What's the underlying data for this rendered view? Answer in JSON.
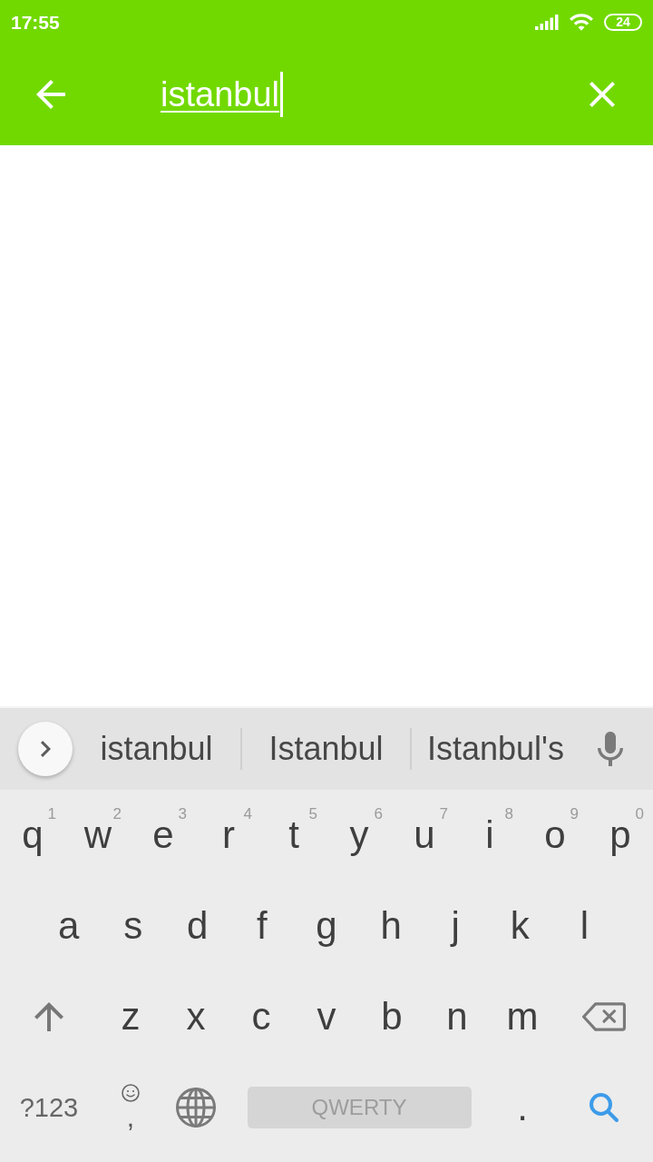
{
  "status_bar": {
    "time": "17:55",
    "battery": "24"
  },
  "search_bar": {
    "query": "istanbul"
  },
  "keyboard": {
    "suggestions": [
      {
        "text": "istanbul"
      },
      {
        "text": "Istanbul"
      },
      {
        "text": "Istanbul's"
      }
    ],
    "rows": [
      {
        "keys": [
          {
            "kind": "letter",
            "label": "q",
            "hint": "1"
          },
          {
            "kind": "letter",
            "label": "w",
            "hint": "2"
          },
          {
            "kind": "letter",
            "label": "e",
            "hint": "3"
          },
          {
            "kind": "letter",
            "label": "r",
            "hint": "4"
          },
          {
            "kind": "letter",
            "label": "t",
            "hint": "5"
          },
          {
            "kind": "letter",
            "label": "y",
            "hint": "6"
          },
          {
            "kind": "letter",
            "label": "u",
            "hint": "7"
          },
          {
            "kind": "letter",
            "label": "i",
            "hint": "8"
          },
          {
            "kind": "letter",
            "label": "o",
            "hint": "9"
          },
          {
            "kind": "letter",
            "label": "p",
            "hint": "0"
          }
        ]
      },
      {
        "keys": [
          {
            "kind": "letter",
            "label": "a"
          },
          {
            "kind": "letter",
            "label": "s"
          },
          {
            "kind": "letter",
            "label": "d"
          },
          {
            "kind": "letter",
            "label": "f"
          },
          {
            "kind": "letter",
            "label": "g"
          },
          {
            "kind": "letter",
            "label": "h"
          },
          {
            "kind": "letter",
            "label": "j"
          },
          {
            "kind": "letter",
            "label": "k"
          },
          {
            "kind": "letter",
            "label": "l"
          }
        ]
      },
      {
        "keys": [
          {
            "kind": "shift"
          },
          {
            "kind": "letter",
            "label": "z"
          },
          {
            "kind": "letter",
            "label": "x"
          },
          {
            "kind": "letter",
            "label": "c"
          },
          {
            "kind": "letter",
            "label": "v"
          },
          {
            "kind": "letter",
            "label": "b"
          },
          {
            "kind": "letter",
            "label": "n"
          },
          {
            "kind": "letter",
            "label": "m"
          },
          {
            "kind": "backspace"
          }
        ]
      },
      {
        "keys": [
          {
            "kind": "symbols",
            "label": "?123"
          },
          {
            "kind": "emoji_comma",
            "label": ","
          },
          {
            "kind": "globe"
          },
          {
            "kind": "space",
            "label": "QWERTY"
          },
          {
            "kind": "letter",
            "label": "."
          },
          {
            "kind": "search"
          }
        ]
      }
    ]
  }
}
